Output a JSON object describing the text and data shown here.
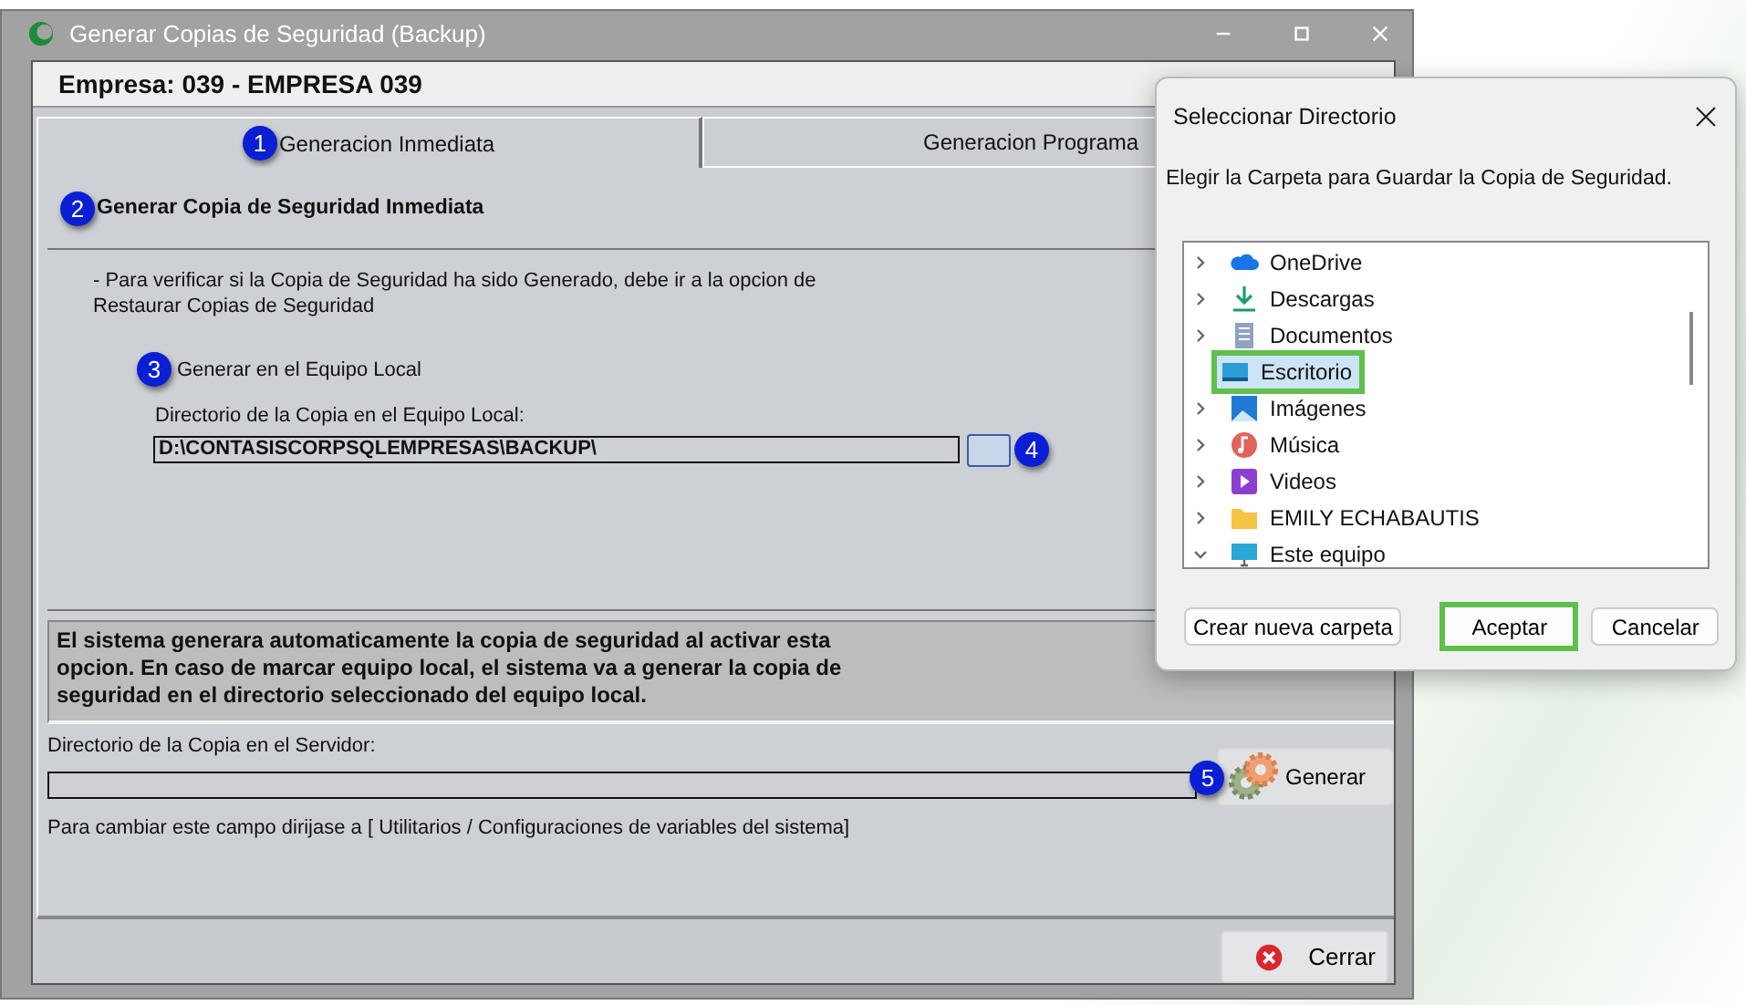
{
  "window": {
    "title": "Generar Copias de Seguridad (Backup)"
  },
  "company": "Empresa: 039 - EMPRESA 039",
  "tabs": [
    {
      "label": "Generacion Inmediata",
      "selected": true,
      "badge": "1"
    },
    {
      "label": "Generacion Programa",
      "selected": false
    }
  ],
  "section": {
    "title": "Generar Copia de Seguridad Inmediata",
    "badge": "2"
  },
  "note": "- Para verificar si la Copia de Seguridad ha sido Generado, debe ir a la opcion de Restaurar Copias de Seguridad",
  "local": {
    "label": "Generar en el Equipo Local",
    "badge": "3",
    "dir_label": "Directorio de la Copia en el Equipo Local:",
    "value": "D:\\CONTASISCORPSQLEMPRESAS\\BACKUP\\",
    "browse_badge": "4"
  },
  "info": "El sistema generara automaticamente la copia de seguridad al activar esta opcion. En caso de marcar equipo local, el sistema va a generar la copia de seguridad en el  directorio seleccionado del equipo local.",
  "server": {
    "dir_label": "Directorio de la Copia en el Servidor:",
    "generate_button": "Generar",
    "badge": "5",
    "hint": "Para cambiar este campo dirijase a [ Utilitarios / Configuraciones de variables del sistema]"
  },
  "close_button": "Cerrar",
  "dialog": {
    "title": "Seleccionar Directorio",
    "instruction": "Elegir la Carpeta para Guardar la Copia de Seguridad.",
    "items": [
      {
        "label": "OneDrive",
        "kind": "cloud",
        "expandable": true,
        "expanded": false,
        "selected": false
      },
      {
        "label": "Descargas",
        "kind": "download",
        "expandable": true,
        "expanded": false,
        "selected": false
      },
      {
        "label": "Documentos",
        "kind": "document",
        "expandable": true,
        "expanded": false,
        "selected": false
      },
      {
        "label": "Escritorio",
        "kind": "desktop",
        "expandable": false,
        "selected": true
      },
      {
        "label": "Imágenes",
        "kind": "images",
        "expandable": true,
        "expanded": false,
        "selected": false
      },
      {
        "label": "Música",
        "kind": "music",
        "expandable": true,
        "expanded": false,
        "selected": false
      },
      {
        "label": "Videos",
        "kind": "video",
        "expandable": true,
        "expanded": false,
        "selected": false
      },
      {
        "label": "EMILY ECHABAUTIS",
        "kind": "folder",
        "expandable": true,
        "expanded": false,
        "selected": false
      },
      {
        "label": "Este equipo",
        "kind": "computer",
        "expandable": true,
        "expanded": true,
        "selected": false
      }
    ],
    "buttons": [
      {
        "label": "Crear nueva carpeta",
        "highlighted": false
      },
      {
        "label": "Aceptar",
        "highlighted": true
      },
      {
        "label": "Cancelar",
        "highlighted": false
      }
    ]
  }
}
